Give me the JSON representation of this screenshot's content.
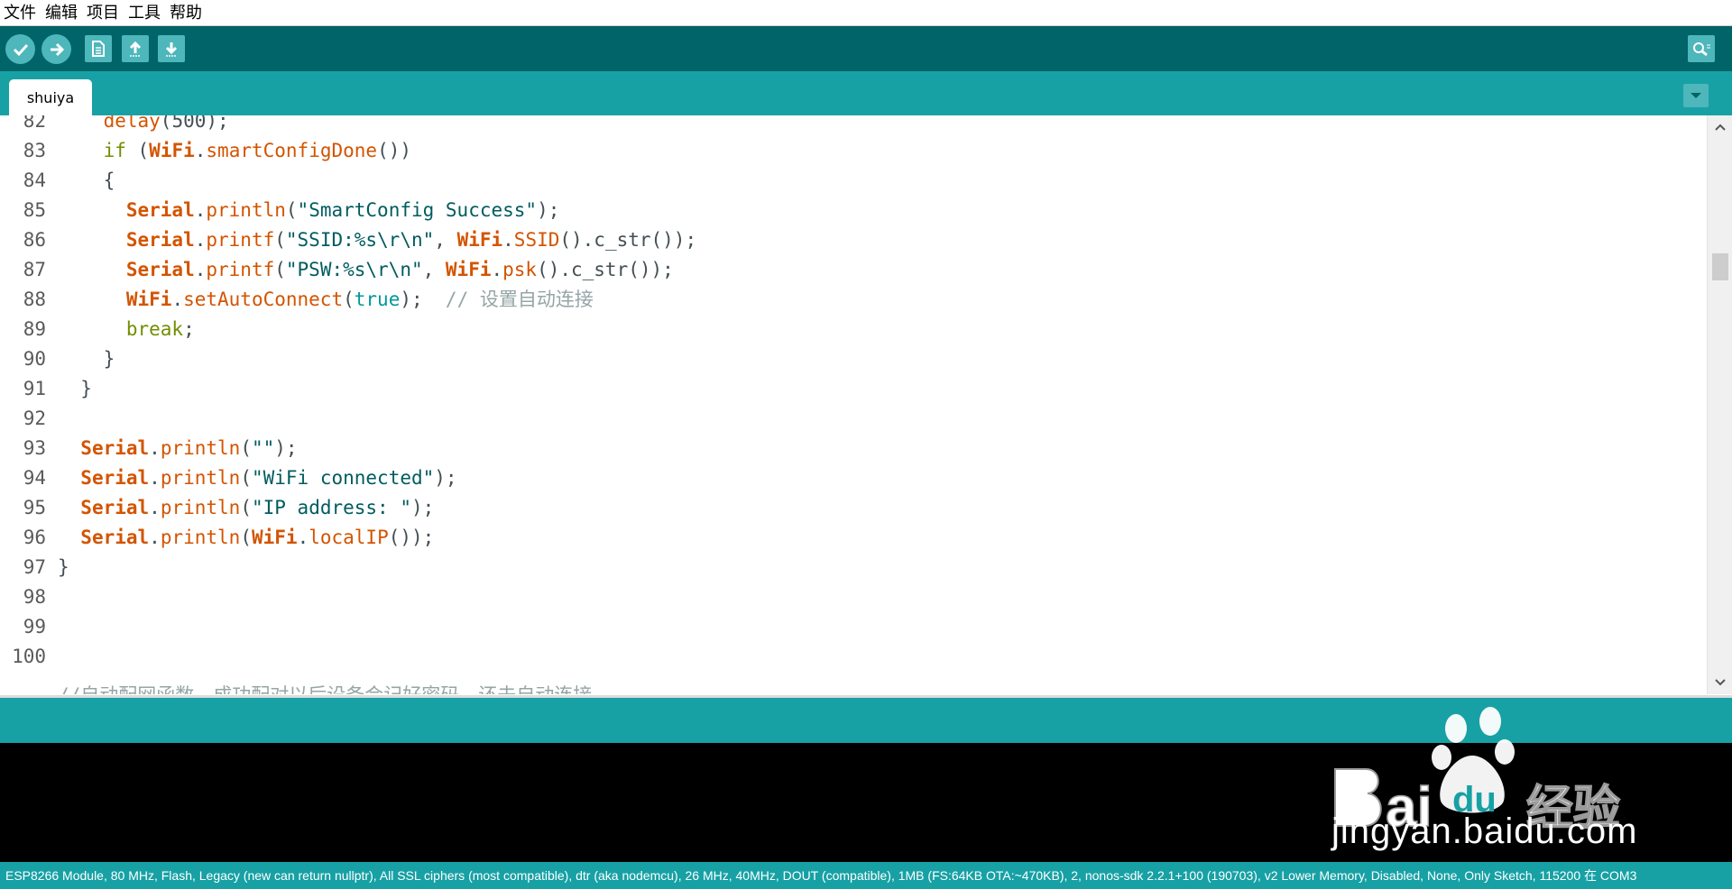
{
  "menu": [
    "文件",
    "编辑",
    "项目",
    "工具",
    "帮助"
  ],
  "toolbar": {
    "verify_icon": "checkmark-icon",
    "upload_icon": "arrow-right-icon",
    "new_icon": "document-icon",
    "open_icon": "arrow-up-icon",
    "save_icon": "arrow-down-icon",
    "serial_monitor_icon": "magnifier-icon"
  },
  "tab": {
    "name": "shuiya"
  },
  "editor": {
    "line_numbers": [
      "82",
      "83",
      "84",
      "85",
      "86",
      "87",
      "88",
      "89",
      "90",
      "91",
      "92",
      "93",
      "94",
      "95",
      "96",
      "97",
      "98",
      "99",
      "100"
    ],
    "lines": [
      [
        [
          "plain",
          "    "
        ],
        [
          "fn",
          "delay"
        ],
        [
          "plain",
          "(500);"
        ]
      ],
      [
        [
          "plain",
          "    "
        ],
        [
          "kw",
          "if"
        ],
        [
          "plain",
          " ("
        ],
        [
          "cls",
          "WiFi"
        ],
        [
          "plain",
          "."
        ],
        [
          "fn",
          "smartConfigDone"
        ],
        [
          "plain",
          "())"
        ]
      ],
      [
        [
          "plain",
          "    {"
        ]
      ],
      [
        [
          "plain",
          "      "
        ],
        [
          "cls",
          "Serial"
        ],
        [
          "plain",
          "."
        ],
        [
          "fn",
          "println"
        ],
        [
          "plain",
          "("
        ],
        [
          "str",
          "\"SmartConfig Success\""
        ],
        [
          "plain",
          ");"
        ]
      ],
      [
        [
          "plain",
          "      "
        ],
        [
          "cls",
          "Serial"
        ],
        [
          "plain",
          "."
        ],
        [
          "fn",
          "printf"
        ],
        [
          "plain",
          "("
        ],
        [
          "str",
          "\"SSID:%s\\r\\n\""
        ],
        [
          "plain",
          ", "
        ],
        [
          "cls",
          "WiFi"
        ],
        [
          "plain",
          "."
        ],
        [
          "fn",
          "SSID"
        ],
        [
          "plain",
          "().c_str());"
        ]
      ],
      [
        [
          "plain",
          "      "
        ],
        [
          "cls",
          "Serial"
        ],
        [
          "plain",
          "."
        ],
        [
          "fn",
          "printf"
        ],
        [
          "plain",
          "("
        ],
        [
          "str",
          "\"PSW:%s\\r\\n\""
        ],
        [
          "plain",
          ", "
        ],
        [
          "cls",
          "WiFi"
        ],
        [
          "plain",
          "."
        ],
        [
          "fn",
          "psk"
        ],
        [
          "plain",
          "().c_str());"
        ]
      ],
      [
        [
          "plain",
          "      "
        ],
        [
          "cls",
          "WiFi"
        ],
        [
          "plain",
          "."
        ],
        [
          "fn",
          "setAutoConnect"
        ],
        [
          "plain",
          "("
        ],
        [
          "lit",
          "true"
        ],
        [
          "plain",
          ");  "
        ],
        [
          "cmt",
          "// 设置自动连接"
        ]
      ],
      [
        [
          "plain",
          "      "
        ],
        [
          "kw",
          "break"
        ],
        [
          "plain",
          ";"
        ]
      ],
      [
        [
          "plain",
          "    }"
        ]
      ],
      [
        [
          "plain",
          "  }"
        ]
      ],
      [
        [
          "plain",
          ""
        ]
      ],
      [
        [
          "plain",
          "  "
        ],
        [
          "cls",
          "Serial"
        ],
        [
          "plain",
          "."
        ],
        [
          "fn",
          "println"
        ],
        [
          "plain",
          "("
        ],
        [
          "str",
          "\"\""
        ],
        [
          "plain",
          ");"
        ]
      ],
      [
        [
          "plain",
          "  "
        ],
        [
          "cls",
          "Serial"
        ],
        [
          "plain",
          "."
        ],
        [
          "fn",
          "println"
        ],
        [
          "plain",
          "("
        ],
        [
          "str",
          "\"WiFi connected\""
        ],
        [
          "plain",
          ");"
        ]
      ],
      [
        [
          "plain",
          "  "
        ],
        [
          "cls",
          "Serial"
        ],
        [
          "plain",
          "."
        ],
        [
          "fn",
          "println"
        ],
        [
          "plain",
          "("
        ],
        [
          "str",
          "\"IP address: \""
        ],
        [
          "plain",
          ");"
        ]
      ],
      [
        [
          "plain",
          "  "
        ],
        [
          "cls",
          "Serial"
        ],
        [
          "plain",
          "."
        ],
        [
          "fn",
          "println"
        ],
        [
          "plain",
          "("
        ],
        [
          "cls",
          "WiFi"
        ],
        [
          "plain",
          "."
        ],
        [
          "fn",
          "localIP"
        ],
        [
          "plain",
          "());"
        ]
      ],
      [
        [
          "plain",
          "}"
        ]
      ],
      [
        [
          "plain",
          ""
        ]
      ],
      [
        [
          "plain",
          ""
        ]
      ],
      [
        [
          "plain",
          ""
        ]
      ]
    ],
    "partial_line": "//自动配网函数，成功配对以后设备会记好密码，还去自动连接"
  },
  "watermark": {
    "url_text": "jingyan.baidu.com",
    "logo_text": "Bai du 经验"
  },
  "status_bar": "ESP8266 Module, 80 MHz, Flash, Legacy (new can return nullptr), All SSL ciphers (most compatible), dtr (aka nodemcu), 26 MHz, 40MHz, DOUT (compatible), 1MB (FS:64KB OTA:~470KB), 2, nonos-sdk 2.2.1+100 (190703), v2 Lower Memory, Disabled, None, Only Sketch, 115200 在 COM3",
  "colors": {
    "toolbar_bg": "#006468",
    "tabbar_bg": "#17a1a5",
    "button_bg": "#4db7bb",
    "keyword": "#728e00",
    "function": "#d35400",
    "string": "#005c5f",
    "literal": "#00979c",
    "comment": "#95a5a6"
  }
}
